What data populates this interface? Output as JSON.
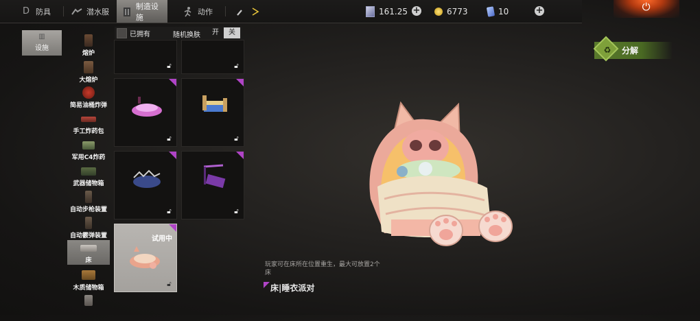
{
  "tabs": [
    {
      "label": "防具",
      "icon": "armor-icon"
    },
    {
      "label": "潜水服",
      "icon": "divesuit-icon"
    },
    {
      "label": "制造设施",
      "icon": "facility-icon",
      "active": true
    },
    {
      "label": "动作",
      "icon": "action-icon"
    },
    {
      "label": "",
      "icon": "brush-icon"
    }
  ],
  "resources": {
    "books": "161.25",
    "coins": "6773",
    "cards": "10"
  },
  "category": {
    "label": "设施",
    "icon": "facility-small-icon"
  },
  "items": [
    {
      "label": "熔炉"
    },
    {
      "label": "大熔炉"
    },
    {
      "label": "简易油桶炸弹"
    },
    {
      "label": "手工炸药包"
    },
    {
      "label": "军用C4炸药"
    },
    {
      "label": "武器储物箱"
    },
    {
      "label": "自动步枪装置"
    },
    {
      "label": "自动霰弹装置"
    },
    {
      "label": "床",
      "selected": true
    },
    {
      "label": "木质储物箱"
    }
  ],
  "filter": {
    "owned_label": "已拥有",
    "random_label": "随机换肤",
    "on_label": "开",
    "off_label": "关"
  },
  "skins": {
    "trial_label": "试用中"
  },
  "decompose_label": "分解",
  "description": "玩家可在床所在位置重生，最大可放置2个床",
  "item_name": "床|睡衣派对",
  "colors": {
    "rarity": "#b044c6",
    "decompose": "#5a7a2c",
    "selected": "#8a8884"
  }
}
